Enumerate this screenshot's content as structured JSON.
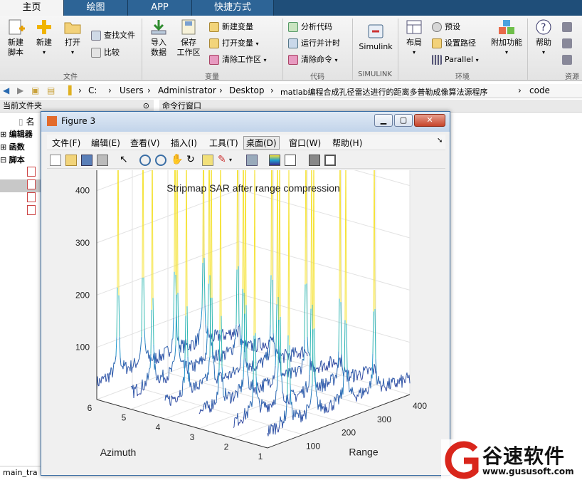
{
  "tabs": [
    "主页",
    "绘图",
    "APP",
    "快捷方式"
  ],
  "ribbon": {
    "new_script": "新建\n脚本",
    "new": "新建",
    "open": "打开",
    "find_files": "查找文件",
    "compare": "比较",
    "import_data": "导入\n数据",
    "save_workspace": "保存\n工作区",
    "new_variable": "新建变量",
    "open_variable": "打开变量",
    "clear_workspace": "清除工作区",
    "analyze_code": "分析代码",
    "run_and_time": "运行并计时",
    "clear_commands": "清除命令",
    "simulink": "Simulink",
    "layout": "布局",
    "preferences": "预设",
    "set_path": "设置路径",
    "parallel": "Parallel",
    "addons": "附加功能",
    "help": "帮助",
    "groups": [
      "文件",
      "变量",
      "代码",
      "SIMULINK",
      "环境",
      "资源"
    ]
  },
  "path": [
    "C:",
    "Users",
    "Administrator",
    "Desktop",
    "matlab编程合成孔径雷达进行的距离多普勒成像算法源程序",
    "code"
  ],
  "current_folder_label": "当前文件夹",
  "command_window_label": "命令行窗口",
  "tree": [
    "编辑器",
    "函数",
    "脚本"
  ],
  "name_col": "名",
  "status_file": "main_tra",
  "figure": {
    "title": "Figure 3",
    "menu": [
      "文件(F)",
      "编辑(E)",
      "查看(V)",
      "插入(I)",
      "工具(T)",
      "桌面(D)",
      "窗口(W)",
      "帮助(H)"
    ]
  },
  "chart_data": {
    "type": "line",
    "subtype": "waterfall-3d",
    "title": "Stripmap SAR after range compression",
    "xlabel": "Range",
    "ylabel": "Azimuth",
    "zlabel": "",
    "x_ticks": [
      100,
      200,
      300,
      400
    ],
    "y_ticks": [
      1,
      2,
      3,
      4,
      5,
      6
    ],
    "z_ticks": [
      100,
      200,
      300,
      400
    ],
    "xlim": [
      0,
      400
    ],
    "ylim": [
      1,
      6
    ],
    "zlim": [
      0,
      450
    ],
    "series_count": 6,
    "peak_ranges": [
      60,
      130,
      220,
      300
    ],
    "peak_height": 460,
    "colormap": [
      "#3b2a8f",
      "#1f9fd0",
      "#36c0a8",
      "#c9d42e",
      "#f5e33a"
    ]
  },
  "watermark": {
    "cn": "谷速软件",
    "url": "www.gususoft.com"
  }
}
